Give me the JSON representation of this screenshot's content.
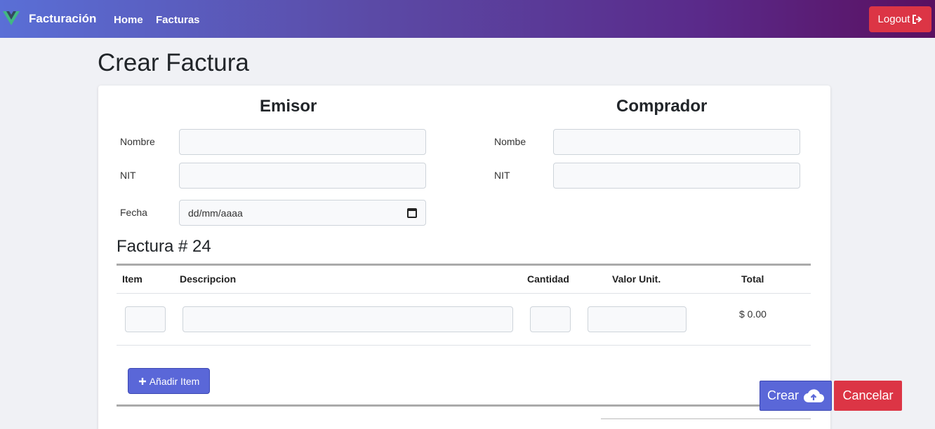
{
  "nav": {
    "brand": "Facturación",
    "links": [
      "Home",
      "Facturas"
    ],
    "logout_label": "Logout"
  },
  "page": {
    "title": "Crear Factura"
  },
  "emisor": {
    "heading": "Emisor",
    "name_label": "Nombre",
    "nit_label": "NIT",
    "date_label": "Fecha",
    "date_placeholder": "dd/mm/aaaa",
    "name_value": "",
    "nit_value": ""
  },
  "comprador": {
    "heading": "Comprador",
    "name_label": "Nombe",
    "nit_label": "NIT",
    "name_value": "",
    "nit_value": ""
  },
  "invoice": {
    "number_label": "Factura # 24",
    "columns": [
      "Item",
      "Descripcion",
      "Cantidad",
      "Valor Unit.",
      "Total"
    ],
    "rows": [
      {
        "item": "",
        "descripcion": "",
        "cantidad": "",
        "valor_unit": "",
        "total": "$ 0.00"
      }
    ],
    "add_item_label": "Añadir Item"
  },
  "actions": {
    "create_label": "Crear",
    "cancel_label": "Cancelar"
  },
  "colors": {
    "primary": "#5a67d8",
    "danger": "#dc3545",
    "nav_start": "#5a6fd6",
    "nav_end": "#5a1060"
  },
  "icons": {
    "brand": "vue-logo-icon",
    "logout": "sign-out-icon",
    "add": "plus-icon",
    "create": "cloud-upload-icon",
    "date": "calendar-icon"
  }
}
